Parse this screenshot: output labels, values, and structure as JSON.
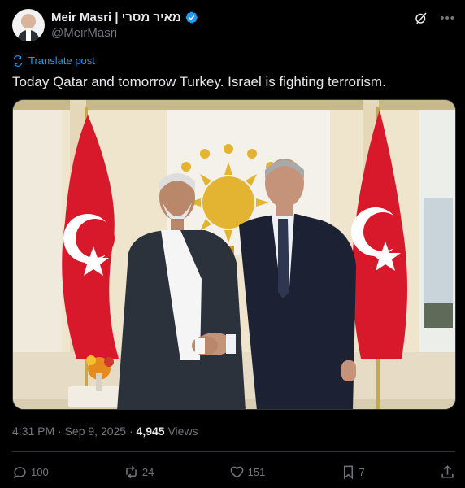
{
  "post": {
    "author": {
      "display_name": "Meir Masri | מאיר מסרי",
      "handle": "@MeirMasri",
      "avatar_icon": "person-avatar",
      "verified": true,
      "verified_color": "#1d9bf0"
    },
    "translate_label": "Translate post",
    "text": "Today Qatar and tomorrow Turkey. Israel is fighting terrorism.",
    "media": {
      "type": "photo",
      "description_icon": "photo"
    },
    "timestamp": "4:31 PM · Sep 9, 2025 · ",
    "views_count": "4,945",
    "views_label": " Views",
    "stats": {
      "replies": "100",
      "reposts": "24",
      "likes": "151",
      "bookmarks": "7"
    }
  },
  "colors": {
    "background": "#000000",
    "text": "#e7e9ea",
    "muted": "#71767b",
    "accent": "#1d9bf0",
    "divider": "#2f3336"
  }
}
